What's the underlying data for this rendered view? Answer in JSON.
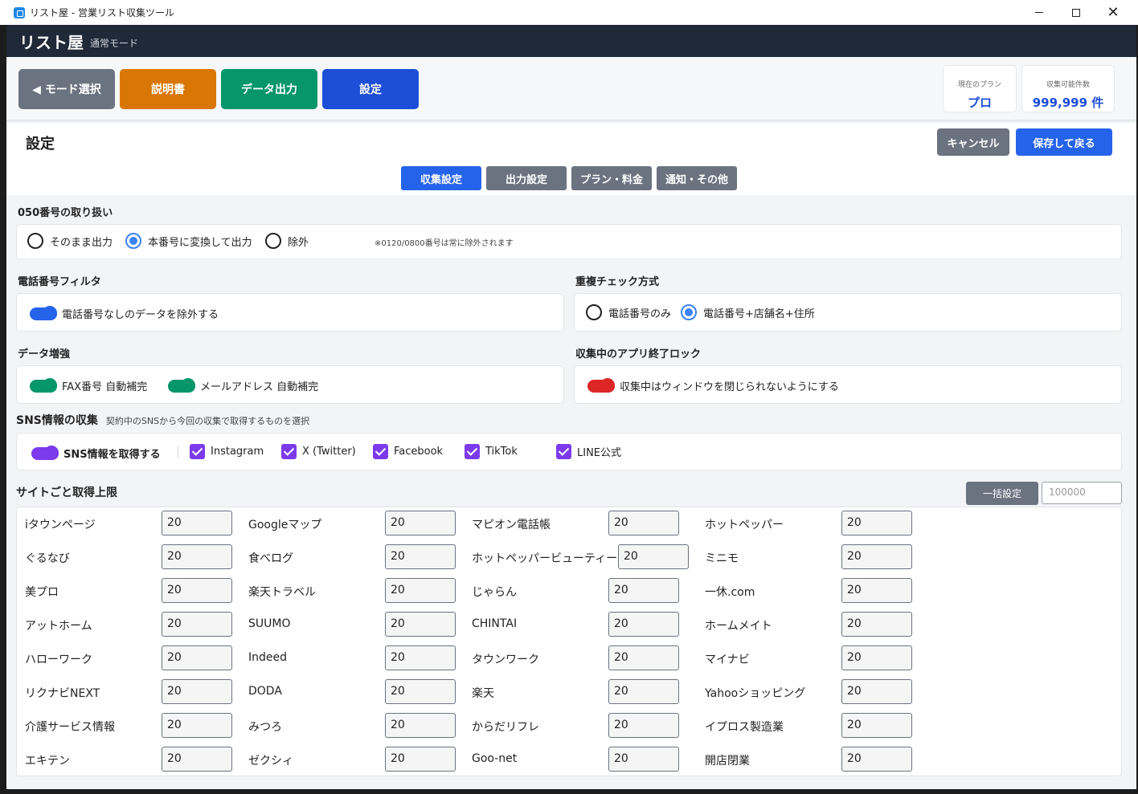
{
  "window": {
    "title": "リスト屋 - 営業リスト収集ツール",
    "minimize": "",
    "maximize": "",
    "close": "✕"
  },
  "app": {
    "name": "リスト屋",
    "mode": "通常モード"
  },
  "toolbar": {
    "mode_select": "◀  モード選択",
    "manual": "説明書",
    "export": "データ出力",
    "settings": "設定"
  },
  "plan": {
    "label": "現在のプラン",
    "value": "プロ"
  },
  "quota": {
    "label": "収集可能件数",
    "value": "999,999 件"
  },
  "settings": {
    "title": "設定",
    "cancel": "キャンセル",
    "save": "保存して戻る",
    "tabs": [
      "収集設定",
      "出力設定",
      "プラン・料金",
      "通知・その他"
    ],
    "active_tab": "収集設定"
  },
  "n050": {
    "title": "050番号の取り扱い",
    "options": [
      "そのまま出力",
      "本番号に変換して出力",
      "除外"
    ],
    "selected": "本番号に変換して出力",
    "note": "※0120/0800番号は常に除外されます"
  },
  "phone_filter": {
    "title": "電話番号フィルタ",
    "toggle": "電話番号なしのデータを除外する",
    "on": true
  },
  "dup_check": {
    "title": "重複チェック方式",
    "options": [
      "電話番号のみ",
      "電話番号+店舗名+住所"
    ],
    "selected": "電話番号+店舗名+住所"
  },
  "enrich": {
    "title": "データ増強",
    "toggles": [
      "FAX番号 自動補完",
      "メールアドレス 自動補完"
    ],
    "on": true
  },
  "app_lock": {
    "title": "収集中のアプリ終了ロック",
    "toggle": "収集中はウィンドウを閉じられないようにする",
    "on": true
  },
  "sns": {
    "title": "SNS情報の収集",
    "subtitle": "契約中のSNSから今回の収集で取得するものを選択",
    "toggle": "SNS情報を取得する",
    "checks": [
      "Instagram",
      "X (Twitter)",
      "Facebook",
      "TikTok",
      "LINE公式"
    ]
  },
  "site_limits": {
    "title": "サイトごと取得上限",
    "bulk_label": "一括設定",
    "bulk_placeholder": "100000",
    "rows": [
      [
        {
          "name": "iタウンページ",
          "value": "20"
        },
        {
          "name": "Googleマップ",
          "value": "20"
        },
        {
          "name": "マピオン電話帳",
          "value": "20"
        },
        {
          "name": "ホットペッパー",
          "value": "20"
        }
      ],
      [
        {
          "name": "ぐるなび",
          "value": "20"
        },
        {
          "name": "食べログ",
          "value": "20"
        },
        {
          "name": "ホットペッパービューティー",
          "value": "20"
        },
        {
          "name": "ミニモ",
          "value": "20"
        }
      ],
      [
        {
          "name": "美プロ",
          "value": "20"
        },
        {
          "name": "楽天トラベル",
          "value": "20"
        },
        {
          "name": "じゃらん",
          "value": "20"
        },
        {
          "name": "一休.com",
          "value": "20"
        }
      ],
      [
        {
          "name": "アットホーム",
          "value": "20"
        },
        {
          "name": "SUUMO",
          "value": "20"
        },
        {
          "name": "CHINTAI",
          "value": "20"
        },
        {
          "name": "ホームメイト",
          "value": "20"
        }
      ],
      [
        {
          "name": "ハローワーク",
          "value": "20"
        },
        {
          "name": "Indeed",
          "value": "20"
        },
        {
          "name": "タウンワーク",
          "value": "20"
        },
        {
          "name": "マイナビ",
          "value": "20"
        }
      ],
      [
        {
          "name": "リクナビNEXT",
          "value": "20"
        },
        {
          "name": "DODA",
          "value": "20"
        },
        {
          "name": "楽天",
          "value": "20"
        },
        {
          "name": "Yahooショッピング",
          "value": "20"
        }
      ],
      [
        {
          "name": "介護サービス情報",
          "value": "20"
        },
        {
          "name": "みつろ",
          "value": "20"
        },
        {
          "name": "からだリフレ",
          "value": "20"
        },
        {
          "name": "イプロス製造業",
          "value": "20"
        }
      ],
      [
        {
          "name": "エキテン",
          "value": "20"
        },
        {
          "name": "ゼクシィ",
          "value": "20"
        },
        {
          "name": "Goo-net",
          "value": "20"
        },
        {
          "name": "開店閉業",
          "value": "20"
        }
      ]
    ]
  }
}
